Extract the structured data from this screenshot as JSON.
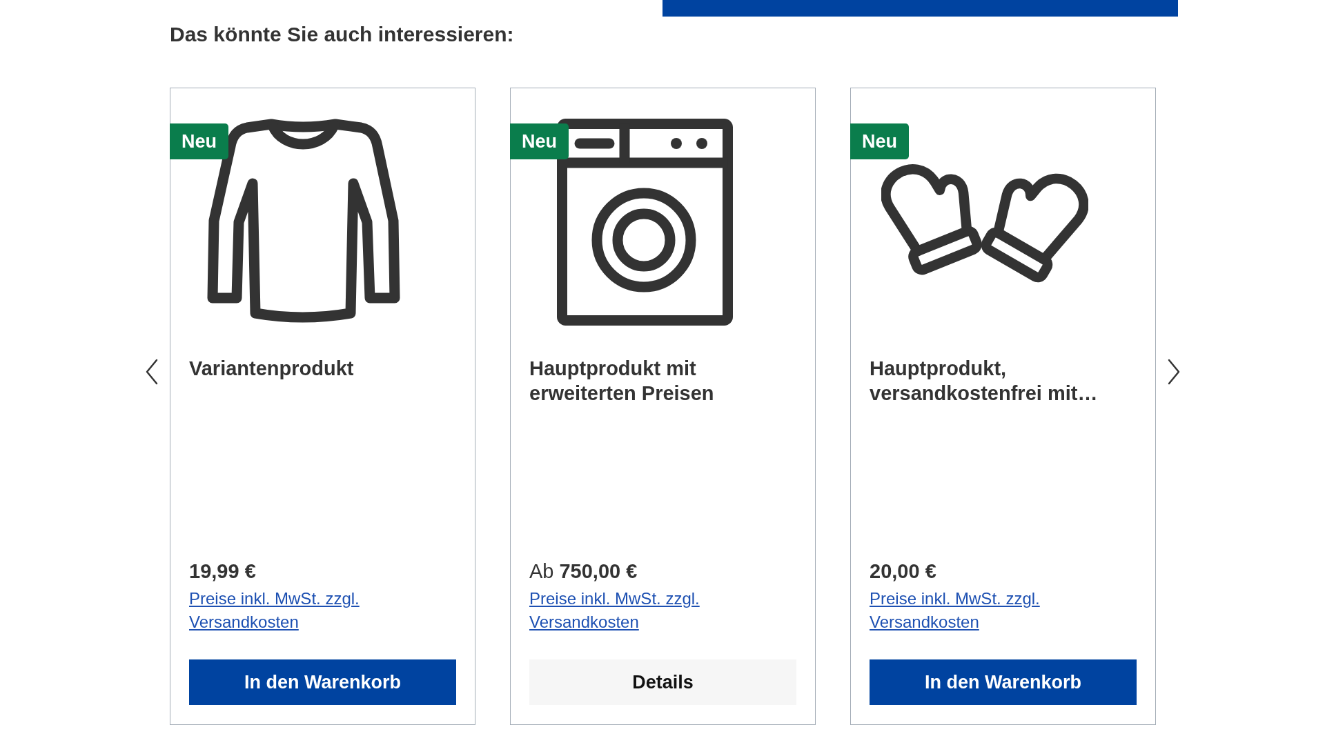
{
  "heading": "Das könnte Sie auch interessieren:",
  "carousel": {
    "products": [
      {
        "kind": "shirt",
        "badge": "Neu",
        "title": "Variantenprodukt",
        "price": "19,99 €",
        "price_note": "Preise inkl. MwSt. zzgl. Versandkosten",
        "button": {
          "kind": "primary",
          "label": "In den Warenkorb"
        }
      },
      {
        "kind": "washing_machine",
        "badge": "Neu",
        "title": "Hauptprodukt mit erweiterten Preisen",
        "price_prefix": "Ab",
        "price": "750,00 €",
        "price_note": "Preise inkl. MwSt. zzgl. Versandkosten",
        "button": {
          "kind": "secondary",
          "label": "Details"
        }
      },
      {
        "kind": "mittens",
        "badge": "Neu",
        "title": "Hauptprodukt, versandkostenfrei mit…",
        "price": "20,00 €",
        "price_note": "Preise inkl. MwSt. zzgl. Versandkosten",
        "button": {
          "kind": "primary",
          "label": "In den Warenkorb"
        }
      }
    ]
  }
}
